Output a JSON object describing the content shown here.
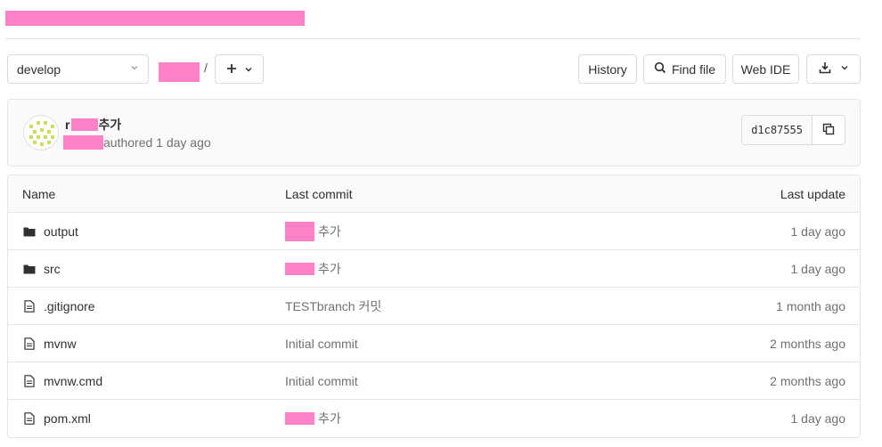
{
  "toolbar": {
    "branch": "develop",
    "path_separator": "/",
    "history_label": "History",
    "find_file_label": "Find file",
    "web_ide_label": "Web IDE"
  },
  "commit": {
    "title_suffix": "추가",
    "meta": "authored 1 day ago",
    "sha": "d1c87555"
  },
  "table": {
    "headers": {
      "name": "Name",
      "last_commit": "Last commit",
      "last_update": "Last update"
    },
    "rows": [
      {
        "name": "output",
        "icon": "folder-icon",
        "commit": "추가",
        "commit_redacted": true,
        "updated": "1 day ago"
      },
      {
        "name": "src",
        "icon": "folder-icon",
        "commit": "추가",
        "commit_redacted": true,
        "updated": "1 day ago"
      },
      {
        "name": ".gitignore",
        "icon": "file-icon",
        "commit": "TESTbranch 커밋",
        "commit_redacted": false,
        "updated": "1 month ago"
      },
      {
        "name": "mvnw",
        "icon": "file-icon",
        "commit": "Initial commit",
        "commit_redacted": false,
        "updated": "2 months ago"
      },
      {
        "name": "mvnw.cmd",
        "icon": "file-icon",
        "commit": "Initial commit",
        "commit_redacted": false,
        "updated": "2 months ago"
      },
      {
        "name": "pom.xml",
        "icon": "file-icon",
        "commit": "추가",
        "commit_redacted": true,
        "updated": "1 day ago"
      }
    ]
  },
  "colors": {
    "redaction": "#ff82c8",
    "border": "#e5e5e5",
    "text": "#303030",
    "muted": "#707070"
  }
}
